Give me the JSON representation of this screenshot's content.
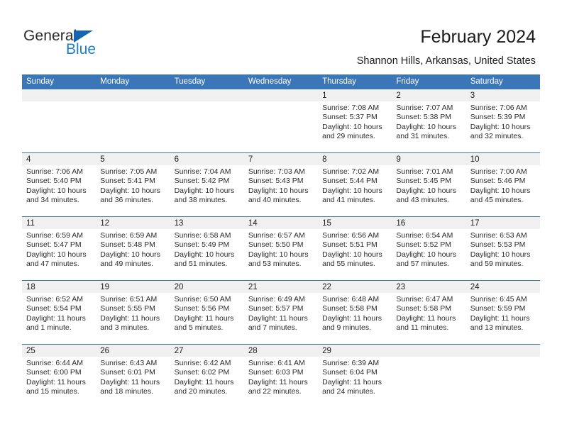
{
  "brand": {
    "name_part1": "General",
    "name_part2": "Blue",
    "accent_color": "#1f7fc4",
    "triangle_color": "#1565b0"
  },
  "header": {
    "title": "February 2024",
    "subtitle": "Shannon Hills, Arkansas, United States"
  },
  "calendar": {
    "header_color": "#3a76b8",
    "daynum_band_color": "#f0f0f0",
    "weekdays": [
      "Sunday",
      "Monday",
      "Tuesday",
      "Wednesday",
      "Thursday",
      "Friday",
      "Saturday"
    ],
    "weeks": [
      [
        {
          "day": "",
          "lines": []
        },
        {
          "day": "",
          "lines": []
        },
        {
          "day": "",
          "lines": []
        },
        {
          "day": "",
          "lines": []
        },
        {
          "day": "1",
          "lines": [
            "Sunrise: 7:08 AM",
            "Sunset: 5:37 PM",
            "Daylight: 10 hours",
            "and 29 minutes."
          ]
        },
        {
          "day": "2",
          "lines": [
            "Sunrise: 7:07 AM",
            "Sunset: 5:38 PM",
            "Daylight: 10 hours",
            "and 31 minutes."
          ]
        },
        {
          "day": "3",
          "lines": [
            "Sunrise: 7:06 AM",
            "Sunset: 5:39 PM",
            "Daylight: 10 hours",
            "and 32 minutes."
          ]
        }
      ],
      [
        {
          "day": "4",
          "lines": [
            "Sunrise: 7:06 AM",
            "Sunset: 5:40 PM",
            "Daylight: 10 hours",
            "and 34 minutes."
          ]
        },
        {
          "day": "5",
          "lines": [
            "Sunrise: 7:05 AM",
            "Sunset: 5:41 PM",
            "Daylight: 10 hours",
            "and 36 minutes."
          ]
        },
        {
          "day": "6",
          "lines": [
            "Sunrise: 7:04 AM",
            "Sunset: 5:42 PM",
            "Daylight: 10 hours",
            "and 38 minutes."
          ]
        },
        {
          "day": "7",
          "lines": [
            "Sunrise: 7:03 AM",
            "Sunset: 5:43 PM",
            "Daylight: 10 hours",
            "and 40 minutes."
          ]
        },
        {
          "day": "8",
          "lines": [
            "Sunrise: 7:02 AM",
            "Sunset: 5:44 PM",
            "Daylight: 10 hours",
            "and 41 minutes."
          ]
        },
        {
          "day": "9",
          "lines": [
            "Sunrise: 7:01 AM",
            "Sunset: 5:45 PM",
            "Daylight: 10 hours",
            "and 43 minutes."
          ]
        },
        {
          "day": "10",
          "lines": [
            "Sunrise: 7:00 AM",
            "Sunset: 5:46 PM",
            "Daylight: 10 hours",
            "and 45 minutes."
          ]
        }
      ],
      [
        {
          "day": "11",
          "lines": [
            "Sunrise: 6:59 AM",
            "Sunset: 5:47 PM",
            "Daylight: 10 hours",
            "and 47 minutes."
          ]
        },
        {
          "day": "12",
          "lines": [
            "Sunrise: 6:59 AM",
            "Sunset: 5:48 PM",
            "Daylight: 10 hours",
            "and 49 minutes."
          ]
        },
        {
          "day": "13",
          "lines": [
            "Sunrise: 6:58 AM",
            "Sunset: 5:49 PM",
            "Daylight: 10 hours",
            "and 51 minutes."
          ]
        },
        {
          "day": "14",
          "lines": [
            "Sunrise: 6:57 AM",
            "Sunset: 5:50 PM",
            "Daylight: 10 hours",
            "and 53 minutes."
          ]
        },
        {
          "day": "15",
          "lines": [
            "Sunrise: 6:56 AM",
            "Sunset: 5:51 PM",
            "Daylight: 10 hours",
            "and 55 minutes."
          ]
        },
        {
          "day": "16",
          "lines": [
            "Sunrise: 6:54 AM",
            "Sunset: 5:52 PM",
            "Daylight: 10 hours",
            "and 57 minutes."
          ]
        },
        {
          "day": "17",
          "lines": [
            "Sunrise: 6:53 AM",
            "Sunset: 5:53 PM",
            "Daylight: 10 hours",
            "and 59 minutes."
          ]
        }
      ],
      [
        {
          "day": "18",
          "lines": [
            "Sunrise: 6:52 AM",
            "Sunset: 5:54 PM",
            "Daylight: 11 hours",
            "and 1 minute."
          ]
        },
        {
          "day": "19",
          "lines": [
            "Sunrise: 6:51 AM",
            "Sunset: 5:55 PM",
            "Daylight: 11 hours",
            "and 3 minutes."
          ]
        },
        {
          "day": "20",
          "lines": [
            "Sunrise: 6:50 AM",
            "Sunset: 5:56 PM",
            "Daylight: 11 hours",
            "and 5 minutes."
          ]
        },
        {
          "day": "21",
          "lines": [
            "Sunrise: 6:49 AM",
            "Sunset: 5:57 PM",
            "Daylight: 11 hours",
            "and 7 minutes."
          ]
        },
        {
          "day": "22",
          "lines": [
            "Sunrise: 6:48 AM",
            "Sunset: 5:58 PM",
            "Daylight: 11 hours",
            "and 9 minutes."
          ]
        },
        {
          "day": "23",
          "lines": [
            "Sunrise: 6:47 AM",
            "Sunset: 5:58 PM",
            "Daylight: 11 hours",
            "and 11 minutes."
          ]
        },
        {
          "day": "24",
          "lines": [
            "Sunrise: 6:45 AM",
            "Sunset: 5:59 PM",
            "Daylight: 11 hours",
            "and 13 minutes."
          ]
        }
      ],
      [
        {
          "day": "25",
          "lines": [
            "Sunrise: 6:44 AM",
            "Sunset: 6:00 PM",
            "Daylight: 11 hours",
            "and 15 minutes."
          ]
        },
        {
          "day": "26",
          "lines": [
            "Sunrise: 6:43 AM",
            "Sunset: 6:01 PM",
            "Daylight: 11 hours",
            "and 18 minutes."
          ]
        },
        {
          "day": "27",
          "lines": [
            "Sunrise: 6:42 AM",
            "Sunset: 6:02 PM",
            "Daylight: 11 hours",
            "and 20 minutes."
          ]
        },
        {
          "day": "28",
          "lines": [
            "Sunrise: 6:41 AM",
            "Sunset: 6:03 PM",
            "Daylight: 11 hours",
            "and 22 minutes."
          ]
        },
        {
          "day": "29",
          "lines": [
            "Sunrise: 6:39 AM",
            "Sunset: 6:04 PM",
            "Daylight: 11 hours",
            "and 24 minutes."
          ]
        },
        {
          "day": "",
          "lines": []
        },
        {
          "day": "",
          "lines": []
        }
      ]
    ]
  }
}
